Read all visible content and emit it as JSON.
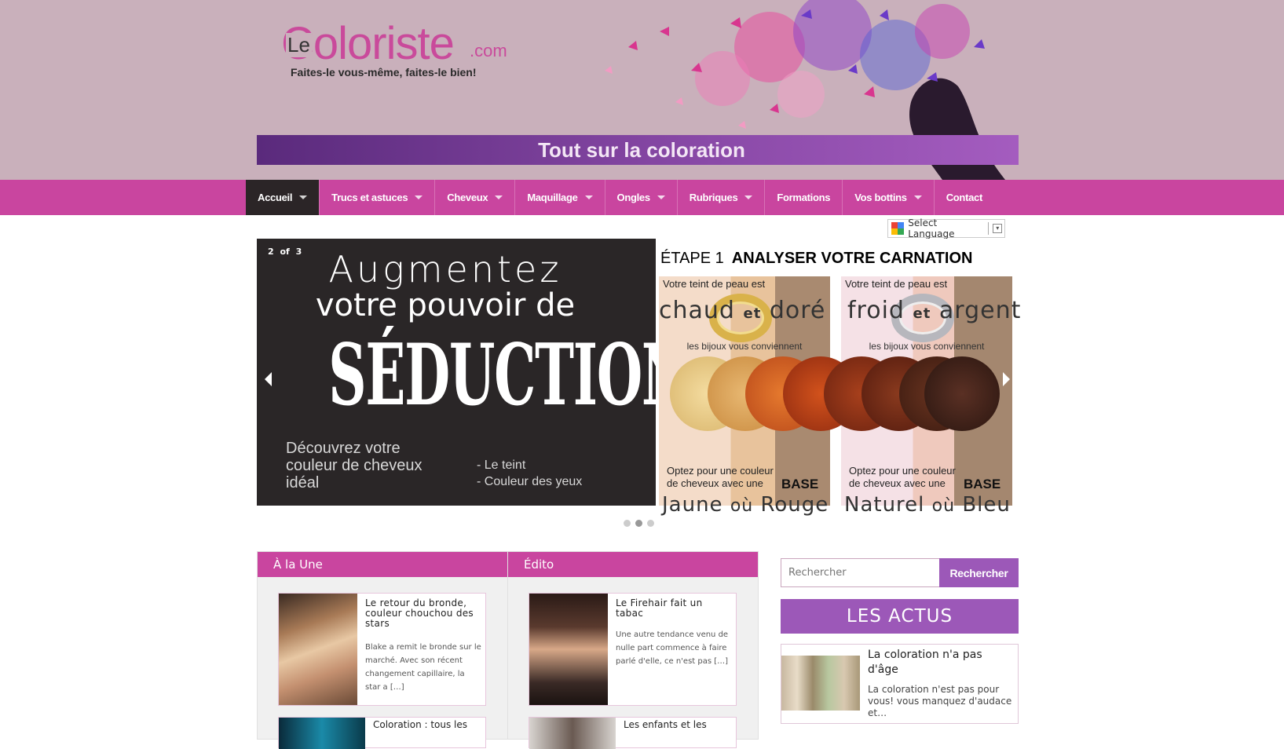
{
  "header": {
    "logo_le": "Le",
    "logo_word": "Coloriste",
    "logo_com": ".com",
    "tagline": "Faites-le vous-même, faites-le bien!",
    "banner": "Tout sur la coloration"
  },
  "nav": {
    "items": [
      {
        "label": "Accueil",
        "dropdown": true,
        "active": true
      },
      {
        "label": "Trucs et astuces",
        "dropdown": true
      },
      {
        "label": "Cheveux",
        "dropdown": true
      },
      {
        "label": "Maquillage",
        "dropdown": true
      },
      {
        "label": "Ongles",
        "dropdown": true
      },
      {
        "label": "Rubriques",
        "dropdown": true
      },
      {
        "label": "Formations",
        "dropdown": false
      },
      {
        "label": "Vos bottins",
        "dropdown": true
      },
      {
        "label": "Contact",
        "dropdown": false
      }
    ]
  },
  "translate": {
    "label": "Select Language"
  },
  "slider": {
    "counter": "2 of 3",
    "heading1": "Augmentez",
    "heading2": "votre pouvoir de",
    "heading3": "SÉDUCTION",
    "discover": "Découvrez votre couleur de cheveux idéal",
    "bullet1": "- Le teint",
    "bullet2": "- Couleur des yeux",
    "etape": "ÉTAPE 1",
    "etape_title": "ANALYSER VOTRE CARNATION",
    "panel_a": {
      "teint": "Votre teint de peau est",
      "word1": "chaud",
      "et": "et",
      "word2": "doré",
      "bijoux": "les bijoux vous conviennent",
      "opt": "Optez pour une couleur de cheveux avec une",
      "base": "BASE",
      "col1": "Jaune",
      "ou": "où",
      "col2": "Rouge"
    },
    "panel_b": {
      "teint": "Votre teint de peau est",
      "word1": "froid",
      "et": "et",
      "word2": "argent",
      "bijoux": "les bijoux vous conviennent",
      "opt": "Optez pour une couleur de cheveux avec une",
      "base": "BASE",
      "col1": "Naturel",
      "ou": "où",
      "col2": "Bleu"
    },
    "active_dot": 2
  },
  "une": {
    "header": "À la Une",
    "card_title": "Le retour du bronde, couleur chouchou des stars",
    "card_text": "Blake a remit le bronde sur le marché.  Avec son récent changement capillaire, la star a […]",
    "card2_title": "Coloration : tous les"
  },
  "edito": {
    "header": "Édito",
    "card_title": "Le Firehair fait un tabac",
    "card_text": "Une autre tendance venu de nulle part commence à faire parlé d'elle, ce n'est pas […]",
    "card2_title": "Les enfants et les"
  },
  "sidebar": {
    "search_placeholder": "Rechercher",
    "search_button": "Rechercher",
    "actus_header": "LES ACTUS",
    "actu_title": "La coloration n'a pas d'âge",
    "actu_text": "La coloration n'est pas pour vous! vous manquez d'audace et…"
  },
  "colors": {
    "nav_pink": "#c9459f",
    "purple": "#9c58b8",
    "header_bg": "#c9b0bb",
    "dark": "#2a2627"
  }
}
